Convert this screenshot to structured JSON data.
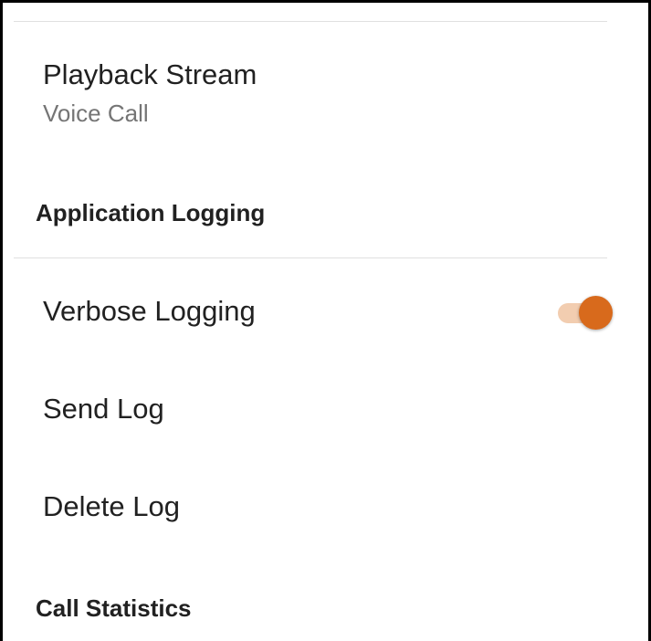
{
  "preferences": {
    "playback_stream": {
      "title": "Playback Stream",
      "summary": "Voice Call"
    },
    "application_logging": {
      "header": "Application Logging",
      "verbose_logging": {
        "title": "Verbose Logging",
        "enabled": true
      },
      "send_log": {
        "title": "Send Log"
      },
      "delete_log": {
        "title": "Delete Log"
      }
    },
    "call_statistics": {
      "header": "Call Statistics"
    }
  },
  "colors": {
    "accent": "#d86a1c",
    "accent_track": "#f2cdb0",
    "summary_text": "#757575",
    "divider": "#e0e0e0"
  }
}
